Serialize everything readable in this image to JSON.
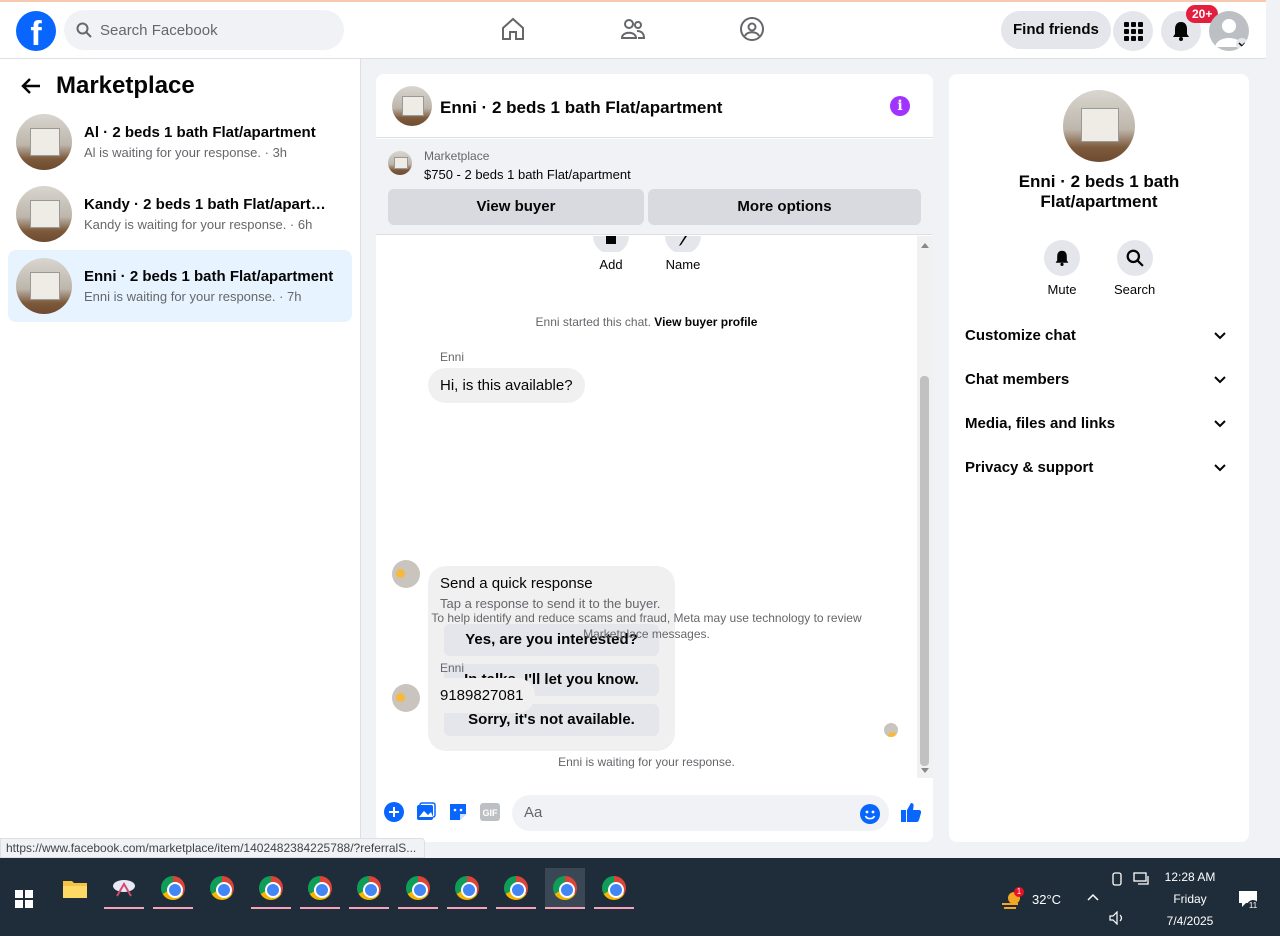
{
  "topbar": {
    "search_placeholder": "Search Facebook",
    "find_friends": "Find friends",
    "notif_badge": "20+"
  },
  "left": {
    "title": "Marketplace",
    "conversations": [
      {
        "name": "Al · 2 beds 1 bath Flat/apartment",
        "sub": "Al is waiting for your response. · 3h",
        "active": false
      },
      {
        "name": "Kandy · 2 beds 1 bath Flat/apartm...",
        "sub": "Kandy is waiting for your response. · 6h",
        "active": false
      },
      {
        "name": "Enni · 2 beds 1 bath Flat/apartment",
        "sub": "Enni is waiting for your response. · 7h",
        "active": true
      }
    ]
  },
  "chat": {
    "title": "Enni · 2 beds 1 bath Flat/apartment",
    "listing_label": "Marketplace",
    "listing_price": "$750 - 2 beds 1 bath Flat/apartment",
    "view_buyer": "View buyer",
    "more_options": "More options",
    "actions": [
      "Add",
      "Name"
    ],
    "started_text": "Enni started this chat.",
    "view_buyer_profile": "View buyer profile",
    "sender1": "Enni",
    "msg1": "Hi, is this available?",
    "quick_title": "Send a quick response",
    "quick_sub": "Tap a response to send it to the buyer.",
    "quick_options": [
      "Yes, are you interested?",
      "In talks. I'll let you know.",
      "Sorry, it's not available."
    ],
    "scam_notice_1": "To help identify and reduce scams and fraud, Meta may use technology to review",
    "scam_notice_2": "Marketplace messages.",
    "sender2": "Enni",
    "msg2": "9189827081",
    "waiting": "Enni is waiting for your response.",
    "input_placeholder": "Aa"
  },
  "right": {
    "title": "Enni · 2 beds 1 bath Flat/apartment",
    "mute": "Mute",
    "search": "Search",
    "rows": [
      "Customize chat",
      "Chat members",
      "Media, files and links",
      "Privacy & support"
    ]
  },
  "status_url": "https://www.facebook.com/marketplace/item/1402482384225788/?referralS...",
  "taskbar": {
    "weather_temp": "32°C",
    "weather_badge": "1",
    "time": "12:28 AM",
    "day": "Friday",
    "date": "7/4/2025",
    "notif_count": "11"
  },
  "colors": {
    "brand": "#0866ff",
    "accent_active": "#e7f3ff",
    "info_purple": "#a033ff",
    "badge_red": "#e41e3f"
  }
}
